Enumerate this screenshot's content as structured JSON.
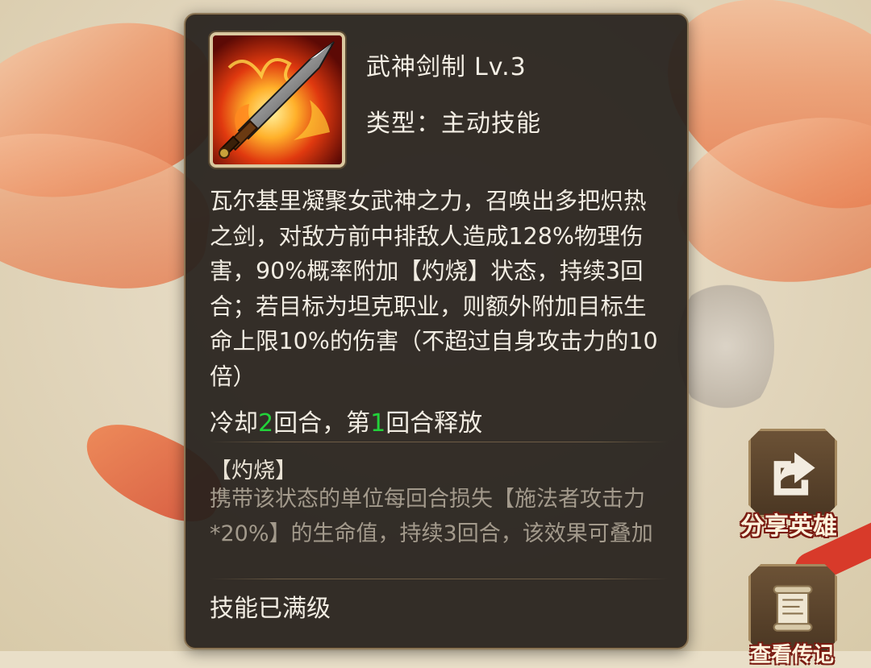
{
  "skill": {
    "name": "武神剑制",
    "level": "Lv.3",
    "type": "类型：主动技能",
    "description": "瓦尔基里凝聚女武神之力，召唤出多把炽热之剑，对敌方前中排敌人造成128%物理伤害，90%概率附加【灼烧】状态，持续3回合；若目标为坦克职业，则额外附加目标生命上限10%的伤害（不超过自身攻击力的10倍）",
    "cooldown": {
      "prefix": "冷却",
      "cooldown_value": "2",
      "middle": "回合，第",
      "release_value": "1",
      "suffix": "回合释放"
    },
    "effect": {
      "title": "【灼烧】",
      "description": "携带该状态的单位每回合损失【施法者攻击力*20%】的生命值，持续3回合，该效果可叠加"
    },
    "status": "技能已满级"
  },
  "side_buttons": {
    "share_label": "分享英雄",
    "second_label": "查看传记"
  },
  "colors": {
    "panel_bg": "#26201c",
    "panel_border": "#8c7656",
    "highlight_number": "#22d23a",
    "effect_text": "#a39a8c"
  },
  "icons": {
    "skill_icon": "flaming-sword-icon",
    "share_icon": "share-icon",
    "scroll_icon": "scroll-icon"
  }
}
